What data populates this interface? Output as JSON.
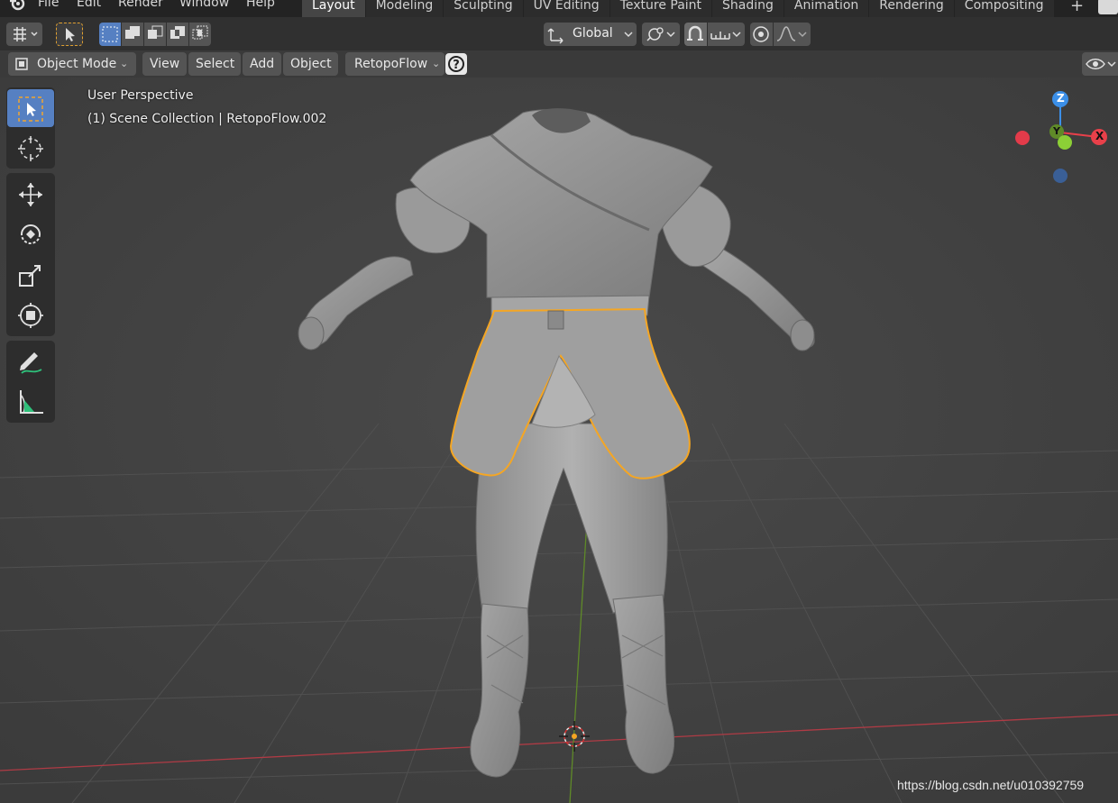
{
  "menubar": {
    "items": [
      "File",
      "Edit",
      "Render",
      "Window",
      "Help"
    ],
    "logo_icon": "blender-logo-icon"
  },
  "workspace_tabs": [
    "Layout",
    "Modeling",
    "Sculpting",
    "UV Editing",
    "Texture Paint",
    "Shading",
    "Animation",
    "Rendering",
    "Compositing"
  ],
  "active_tab": "Layout",
  "add_workspace_label": "+",
  "tool_header": {
    "transform_orientation": "Global",
    "icons": [
      "tool-settings-icon",
      "select-tool-icon",
      "select-box-icon",
      "mode-extend-icon",
      "mode-subtract-icon",
      "mode-difference-icon",
      "mode-intersect-icon",
      "orientation-icon",
      "pivot-icon",
      "snap-magnet-icon",
      "snap-increment-icon",
      "proportional-edit-icon",
      "falloff-icon"
    ]
  },
  "viewport_header": {
    "mode": "Object Mode",
    "menus": [
      "View",
      "Select",
      "Add",
      "Object"
    ],
    "addon": "RetopoFlow",
    "help_label": "?"
  },
  "viewport": {
    "perspective_label": "User Perspective",
    "collection_label": "(1) Scene Collection | RetopoFlow.002",
    "gizmo": {
      "z": "Z",
      "y": "Y",
      "x": "X"
    }
  },
  "toolbar_tools": [
    "select-box-icon",
    "cursor-icon",
    "move-icon",
    "rotate-icon",
    "scale-icon",
    "transform-icon",
    "annotate-icon",
    "measure-icon"
  ],
  "colors": {
    "selection_outline": "#f5a623",
    "active_tool": "#5680c2",
    "x_axis": "#e8404a",
    "y_axis": "#7fbf30",
    "z_axis": "#3b8fe8"
  },
  "watermark": "https://blog.csdn.net/u010392759"
}
